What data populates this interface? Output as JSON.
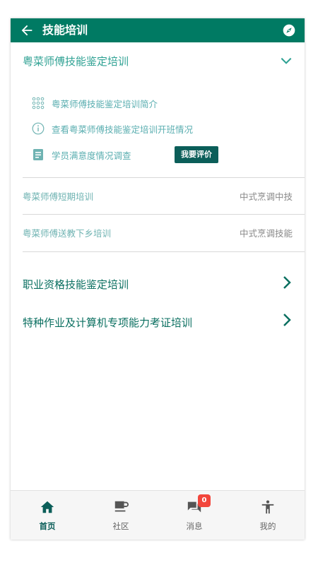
{
  "header": {
    "title": "技能培训"
  },
  "sections": {
    "cantonese": {
      "title": "粤菜师傅技能鉴定培训",
      "sub_items": [
        {
          "label": "粤菜师傅技能鉴定培训简介",
          "icon": "grid-dots-icon"
        },
        {
          "label": "查看粤菜师傅技能鉴定培训开班情况",
          "icon": "info-icon"
        },
        {
          "label": "学员满意度情况调查",
          "icon": "document-icon"
        }
      ],
      "evaluate_button": "我要评价"
    },
    "rows": [
      {
        "left": "粤菜师傅短期培训",
        "right": "中式烹调中技"
      },
      {
        "left": "粤菜师傅送教下乡培训",
        "right": "中式烹调技能"
      }
    ],
    "main_items": [
      {
        "label": "职业资格技能鉴定培训"
      },
      {
        "label": "特种作业及计算机专项能力考证培训"
      }
    ]
  },
  "bottom_nav": [
    {
      "label": "首页",
      "icon": "home-icon",
      "active": true
    },
    {
      "label": "社区",
      "icon": "coffee-cup-icon",
      "active": false
    },
    {
      "label": "消息",
      "icon": "chat-icon",
      "active": false,
      "badge": "0"
    },
    {
      "label": "我的",
      "icon": "person-icon",
      "active": false
    }
  ],
  "colors": {
    "primary": "#007a63",
    "accent_text": "#2ea193",
    "badge": "#f2463c",
    "button": "#0b5e59"
  }
}
